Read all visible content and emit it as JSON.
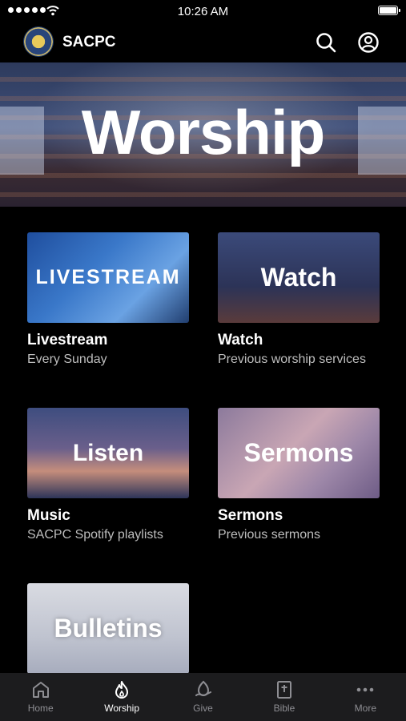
{
  "status_bar": {
    "time": "10:26 AM"
  },
  "header": {
    "title": "SACPC"
  },
  "hero": {
    "title": "Worship"
  },
  "cards": [
    {
      "thumb_text": "LIVESTREAM",
      "title": "Livestream",
      "subtitle": "Every Sunday"
    },
    {
      "thumb_text": "Watch",
      "title": "Watch",
      "subtitle": "Previous worship services"
    },
    {
      "thumb_text": "Listen",
      "title": "Music",
      "subtitle": "SACPC Spotify playlists"
    },
    {
      "thumb_text": "Sermons",
      "title": "Sermons",
      "subtitle": "Previous sermons"
    },
    {
      "thumb_text": "Bulletins",
      "title": "",
      "subtitle": ""
    }
  ],
  "tabs": [
    {
      "label": "Home",
      "icon": "home-icon",
      "active": false
    },
    {
      "label": "Worship",
      "icon": "flame-icon",
      "active": true
    },
    {
      "label": "Give",
      "icon": "give-icon",
      "active": false
    },
    {
      "label": "Bible",
      "icon": "bible-icon",
      "active": false
    },
    {
      "label": "More",
      "icon": "more-icon",
      "active": false
    }
  ],
  "colors": {
    "background": "#000000",
    "tabbar": "#1c1c1e",
    "inactive_tab": "#8e8e93",
    "subtitle": "#bdbdbd"
  }
}
